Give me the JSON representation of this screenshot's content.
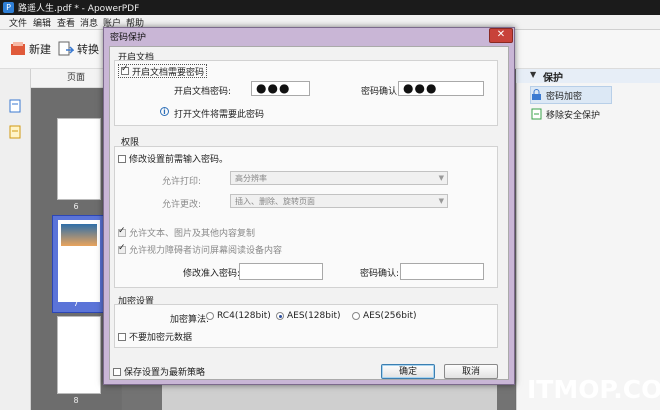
{
  "app": {
    "title": "路遥人生.pdf * - ApowerPDF",
    "menu": [
      "文件",
      "编辑",
      "查看",
      "消息",
      "账户",
      "帮助"
    ],
    "toolbar": {
      "new_label": "新建",
      "convert_label": "转换"
    },
    "pages_header": "页面",
    "page_numbers": [
      "6",
      "7",
      "8"
    ],
    "right_panel": {
      "section": "保护",
      "items": [
        "密码加密",
        "移除安全保护"
      ]
    },
    "watermark": "ITMOP.COM"
  },
  "dialog": {
    "title": "密码保护",
    "close_glyph": "✕",
    "open_doc": {
      "title": "开启文档",
      "require_password_label": "开启文档需要密码",
      "open_password_label": "开启文档密码:",
      "open_password_value": "●●●",
      "confirm_label": "密码确认:",
      "confirm_value": "●●●",
      "info_text": "打开文件将需要此密码"
    },
    "permissions": {
      "title": "权限",
      "modify_require_label": "修改设置前需输入密码。",
      "print_label": "允许打印:",
      "print_value": "高分辨率",
      "change_label": "允许更改:",
      "change_value": "插入、删除、旋转页面",
      "copy_label": "允许文本、图片及其他内容复制",
      "screenreader_label": "允许视力障碍者访问屏幕阅读设备内容",
      "modify_password_label": "修改准入密码:",
      "modify_confirm_label": "密码确认:"
    },
    "encryption": {
      "title": "加密设置",
      "algo_label": "加密算法:",
      "options": [
        "RC4(128bit)",
        "AES(128bit)",
        "AES(256bit)"
      ],
      "selected": "AES(128bit)",
      "no_metadata_label": "不要加密元数据"
    },
    "save_default_label": "保存设置为最新策略",
    "ok_label": "确定",
    "cancel_label": "取消"
  }
}
